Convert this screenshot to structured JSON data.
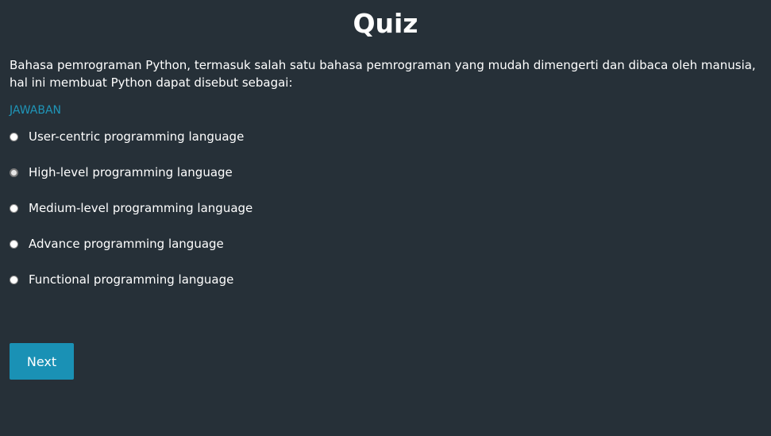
{
  "quiz": {
    "title": "Quiz",
    "question": "Bahasa pemrograman Python, termasuk salah satu bahasa pemrograman yang mudah dimengerti dan dibaca oleh manusia, hal ini membuat Python dapat disebut sebagai:",
    "answer_label": "JAWABAN",
    "options": [
      {
        "label": "User-centric programming language",
        "selected": false
      },
      {
        "label": "High-level programming language",
        "selected": false
      },
      {
        "label": "Medium-level programming language",
        "selected": false
      },
      {
        "label": "Advance programming language",
        "selected": false
      },
      {
        "label": "Functional programming language",
        "selected": false
      }
    ],
    "next_label": "Next"
  },
  "colors": {
    "background": "#263038",
    "accent": "#1a91b5",
    "answer_label": "#1f95b8",
    "text": "#ffffff"
  }
}
